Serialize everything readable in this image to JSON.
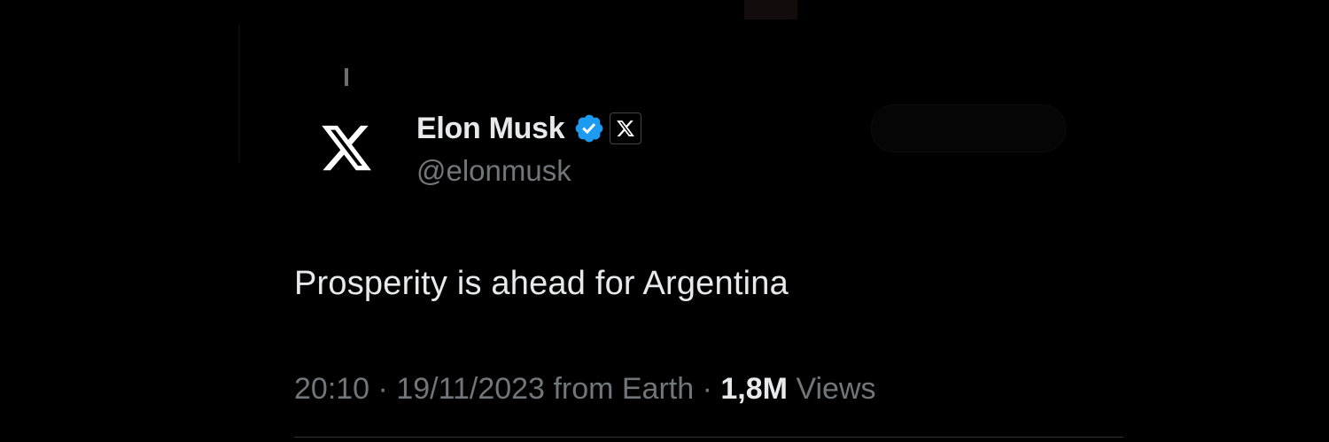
{
  "tweet": {
    "author": {
      "display_name": "Elon Musk",
      "handle": "@elonmusk",
      "avatar_icon": "x-logo-icon",
      "verified_icon": "verified-badge-icon",
      "affiliate_icon": "x-affiliate-badge-icon"
    },
    "text": "Prosperity is ahead for Argentina",
    "meta": {
      "time": "20:10",
      "separator": "·",
      "date": "19/11/2023",
      "source": "from Earth",
      "views_count": "1,8M",
      "views_label": "Views"
    }
  },
  "colors": {
    "background": "#000000",
    "primary_text": "#e7e9ea",
    "secondary_text": "#71767b",
    "verified_blue": "#1d9bf0",
    "divider": "#2f3336"
  }
}
